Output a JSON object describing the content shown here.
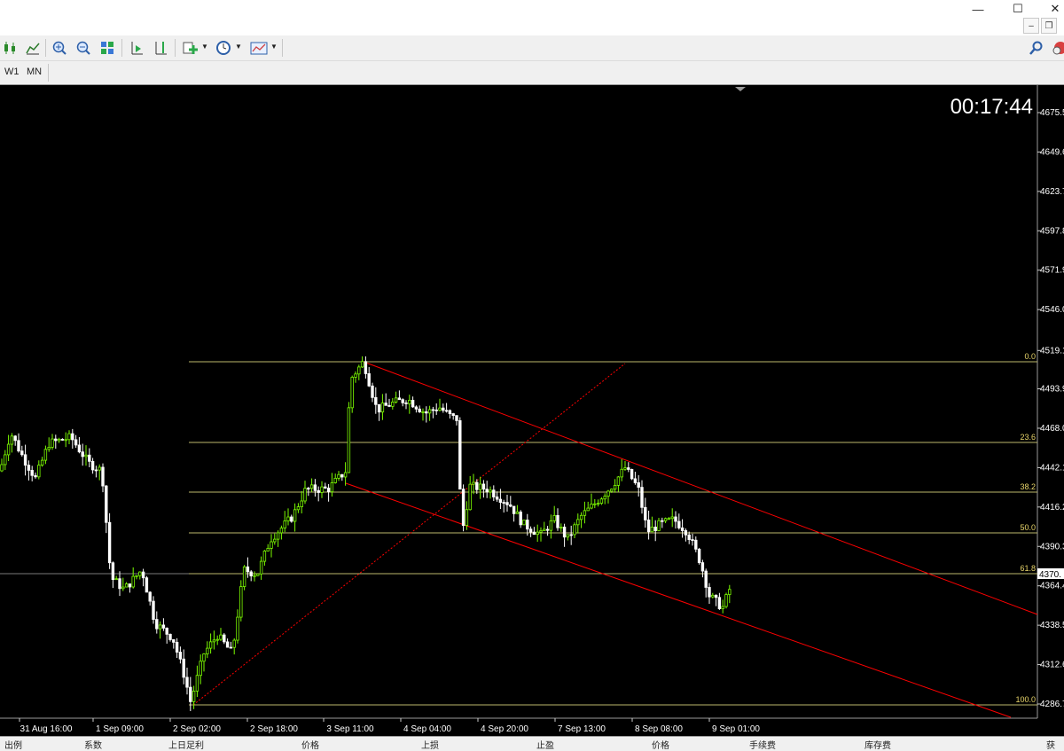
{
  "window": {
    "minimize_glyph": "—",
    "maximize_glyph": "☐",
    "close_glyph": "✕",
    "mdi_min": "–",
    "mdi_restore": "❐"
  },
  "toolbar": {
    "icons": [
      "candles-icon",
      "line-chart-icon",
      "zoom-in-icon",
      "zoom-out-icon",
      "tile-windows-icon",
      "autoscroll-icon",
      "chart-shift-icon",
      "indicators-icon",
      "periods-icon",
      "templates-icon"
    ]
  },
  "timeframes": [
    "W1",
    "MN"
  ],
  "chart": {
    "timer": "00:17:44",
    "current_price_label": "4370.",
    "colors": {
      "background": "#000000",
      "bull": "#7CFC00",
      "bear": "#FFFFFF",
      "fib": "#BDB76B",
      "channel": "#FF0000",
      "axis_text": "#FFFFFF"
    }
  },
  "chart_data": {
    "type": "candlestick",
    "price_axis_labels": [
      "4675.5",
      "4649.6",
      "4623.7",
      "4597.8",
      "4571.9",
      "4546.0",
      "4519.1",
      "4493.9",
      "4468.0",
      "4442.1",
      "4416.2",
      "4390.3",
      "4364.4",
      "4338.5",
      "4312.6",
      "4286.7"
    ],
    "time_axis_labels": [
      "31 Aug 16:00",
      "1 Sep 09:00",
      "2 Sep 02:00",
      "2 Sep 18:00",
      "3 Sep 11:00",
      "4 Sep 04:00",
      "4 Sep 20:00",
      "7 Sep 13:00",
      "8 Sep 08:00",
      "9 Sep 01:00"
    ],
    "fibonacci_levels": [
      "0.0",
      "23.6",
      "38.2",
      "50.0",
      "61.8",
      "100.0"
    ],
    "ylim": [
      4280,
      4685
    ],
    "keypoints": [
      [
        0,
        4440
      ],
      [
        12,
        4465
      ],
      [
        25,
        4450
      ],
      [
        40,
        4435
      ],
      [
        55,
        4458
      ],
      [
        80,
        4462
      ],
      [
        100,
        4445
      ],
      [
        115,
        4440
      ],
      [
        125,
        4370
      ],
      [
        140,
        4362
      ],
      [
        160,
        4375
      ],
      [
        175,
        4340
      ],
      [
        195,
        4330
      ],
      [
        208,
        4305
      ],
      [
        215,
        4288
      ],
      [
        230,
        4320
      ],
      [
        245,
        4332
      ],
      [
        262,
        4320
      ],
      [
        275,
        4375
      ],
      [
        290,
        4372
      ],
      [
        305,
        4395
      ],
      [
        330,
        4410
      ],
      [
        345,
        4428
      ],
      [
        370,
        4428
      ],
      [
        390,
        4440
      ],
      [
        395,
        4500
      ],
      [
        410,
        4512
      ],
      [
        425,
        4480
      ],
      [
        445,
        4485
      ],
      [
        460,
        4487
      ],
      [
        480,
        4478
      ],
      [
        495,
        4482
      ],
      [
        510,
        4475
      ],
      [
        517,
        4474
      ],
      [
        520,
        4395
      ],
      [
        530,
        4430
      ],
      [
        550,
        4428
      ],
      [
        575,
        4418
      ],
      [
        590,
        4405
      ],
      [
        610,
        4398
      ],
      [
        625,
        4408
      ],
      [
        640,
        4395
      ],
      [
        655,
        4410
      ],
      [
        670,
        4418
      ],
      [
        690,
        4430
      ],
      [
        705,
        4442
      ],
      [
        720,
        4428
      ],
      [
        730,
        4400
      ],
      [
        745,
        4405
      ],
      [
        760,
        4408
      ],
      [
        775,
        4400
      ],
      [
        790,
        4380
      ],
      [
        800,
        4358
      ],
      [
        815,
        4350
      ],
      [
        828,
        4370
      ]
    ]
  },
  "status_columns": [
    "出例",
    "系数",
    "上日足利",
    "价格",
    "上损",
    "止盈",
    "价格",
    "利润",
    "手续费",
    "库存费",
    "获"
  ]
}
